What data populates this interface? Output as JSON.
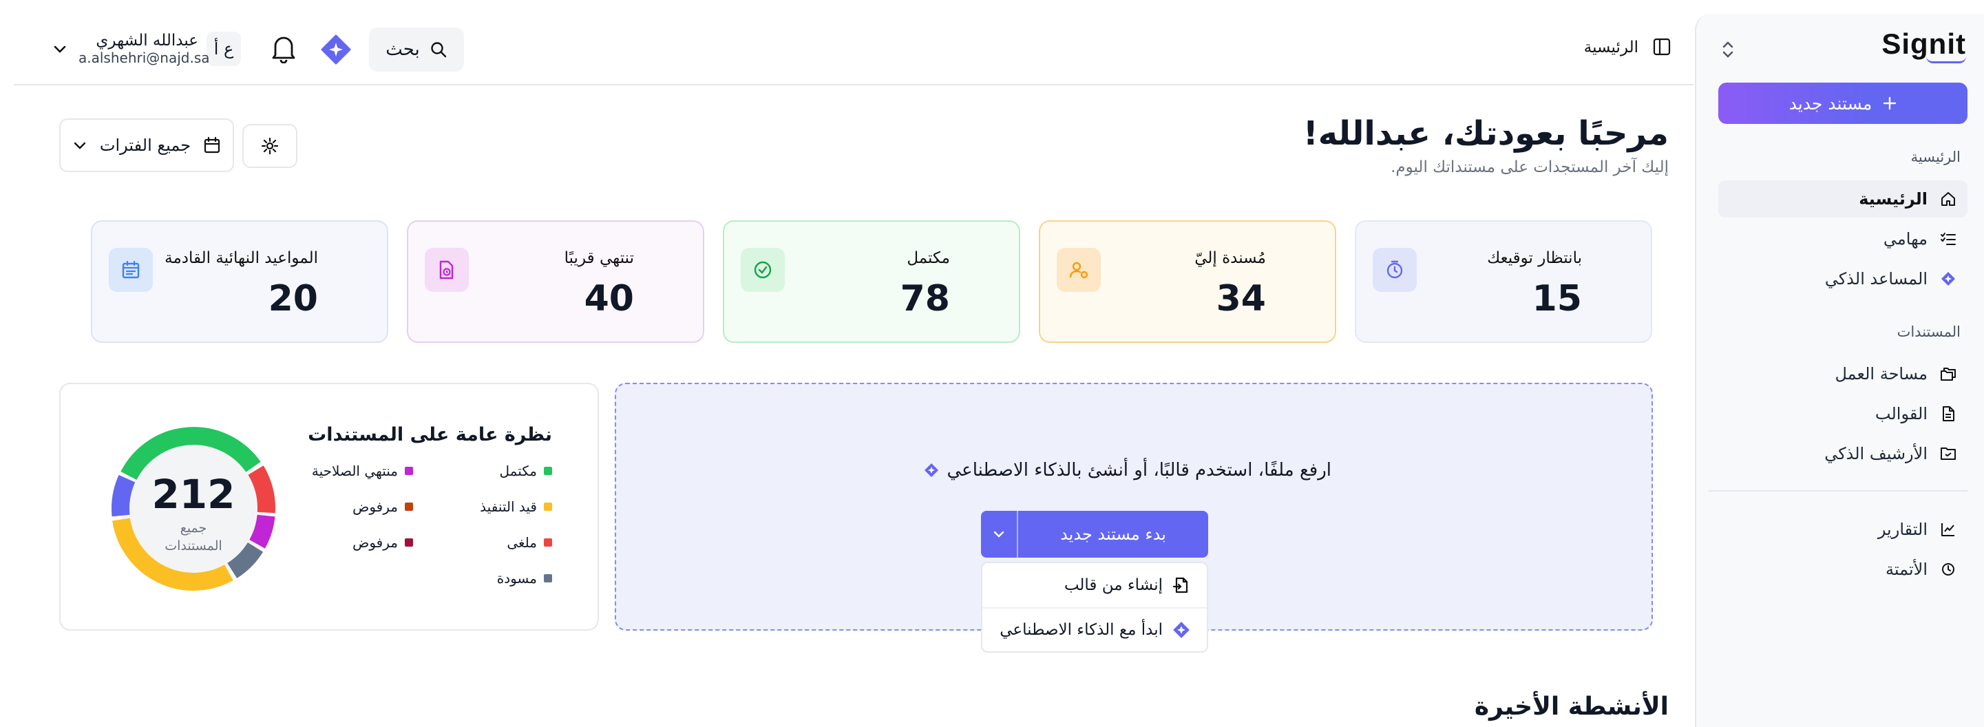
{
  "sidebar": {
    "logo": "Signit",
    "new_doc": "مستند جديد",
    "section_home": "الرئيسية",
    "section_docs": "المستندات",
    "items": [
      {
        "label": "الرئيسية"
      },
      {
        "label": "مهامي"
      },
      {
        "label": "المساعد الذكي"
      },
      {
        "label": "مساحة العمل"
      },
      {
        "label": "القوالب"
      },
      {
        "label": "الأرشيف الذكي"
      },
      {
        "label": "التقارير"
      },
      {
        "label": "الأتمتة"
      }
    ]
  },
  "header": {
    "breadcrumb": "الرئيسية",
    "search": "بحث",
    "lang": "ع أ",
    "user_name": "عبدالله الشهري",
    "user_email": "a.alshehri@najd.sa"
  },
  "main": {
    "welcome": "مرحبًا بعودتك، عبدالله!",
    "subtitle": "إليك آخر المستجدات على مستنداتك اليوم.",
    "period": "جميع الفترات",
    "stats": [
      {
        "label": "بانتظار توقيعك",
        "value": "15",
        "color": "#6366f1"
      },
      {
        "label": "مُسندة إليّ",
        "value": "34",
        "color": "#f59e0b"
      },
      {
        "label": "مكتمل",
        "value": "78",
        "color": "#22c55e"
      },
      {
        "label": "تنتهي قريبًا",
        "value": "40",
        "color": "#c026d3"
      },
      {
        "label": "المواعيد النهائية القادمة",
        "value": "20",
        "color": "#3b82f6"
      }
    ],
    "upload_text": "ارفع ملفًا، استخدم قالبًا، أو أنشئ بالذكاء الاصطناعي",
    "start_button": "بدء مستند جديد",
    "menu": [
      "إنشاء من قالب",
      "ابدأ مع الذكاء الاصطناعي"
    ],
    "recent": "الأنشطة الأخيرة"
  },
  "overview": {
    "title": "نظرة عامة على المستندات",
    "total": "212",
    "total_label_1": "جميع",
    "total_label_2": "المستندات",
    "legend": [
      {
        "label": "مكتمل",
        "color": "#22c55e"
      },
      {
        "label": "قيد التنفيذ",
        "color": "#fbbf24"
      },
      {
        "label": "ملغى",
        "color": "#ef4444"
      },
      {
        "label": "مسودة",
        "color": "#64748b"
      },
      {
        "label": "منتهي الصلاحية",
        "color": "#c026d3"
      },
      {
        "label": "مرفوض",
        "color": "#c2410c"
      },
      {
        "label": "مرفوض",
        "color": "#9f1239"
      }
    ]
  }
}
